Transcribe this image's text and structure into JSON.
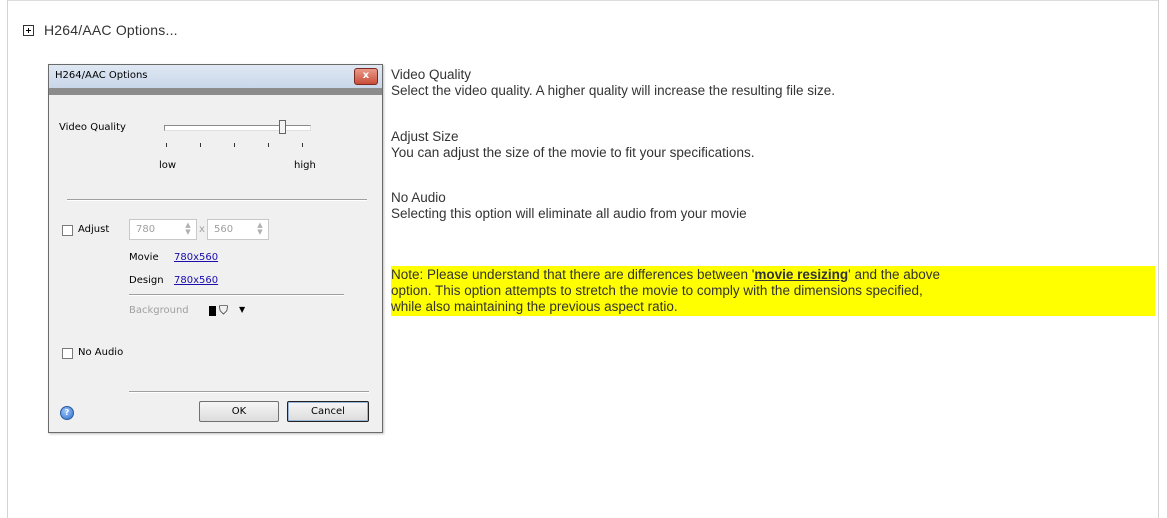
{
  "section": {
    "title": "H264/AAC Options..."
  },
  "dialog": {
    "title": "H264/AAC Options",
    "close": "x",
    "video_quality_label": "Video Quality",
    "low": "low",
    "high": "high",
    "video_quality_value": 0.8,
    "adjust_label": "Adjust",
    "adjust_checked": false,
    "width_value": "780",
    "times": "x",
    "height_value": "560",
    "movie_label": "Movie",
    "movie_size": "780x560",
    "design_label": "Design",
    "design_size": "780x560",
    "background_label": "Background",
    "no_audio_label": "No Audio",
    "no_audio_checked": false,
    "ok_label": "OK",
    "cancel_label": "Cancel",
    "help_glyph": "?"
  },
  "descriptions": [
    {
      "heading": "Video Quality",
      "text": "Select the video quality. A higher quality will increase the resulting file size."
    },
    {
      "heading": "Adjust Size",
      "text": "You can adjust the size of the movie to fit your specifications."
    },
    {
      "heading": "No Audio",
      "text": "Selecting this option will eliminate all audio from your movie"
    }
  ],
  "note": {
    "prefix": "Note: Please understand that there are differences between '",
    "link": "movie resizing",
    "suffix": "' and the above",
    "line2": "option. This option attempts to stretch the movie to comply with the dimensions specified,",
    "line3": "while also maintaining the previous aspect ratio."
  },
  "colors": {
    "note_highlight": "#ffff00",
    "link": "#1a0dab"
  }
}
